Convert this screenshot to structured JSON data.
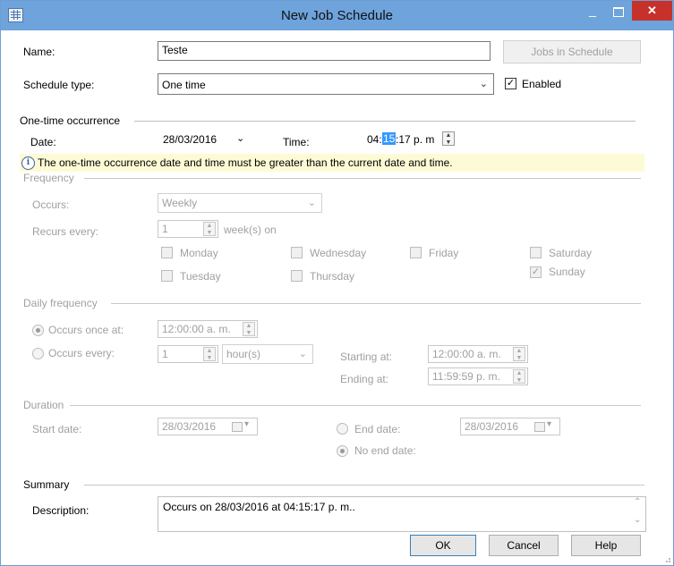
{
  "window": {
    "title": "New Job Schedule",
    "minimize_glyph": "_",
    "close_glyph": "✕"
  },
  "icons": {
    "app": "calendar-grid-icon",
    "info": "info-icon"
  },
  "name": {
    "label": "Name:",
    "value": "Teste",
    "jobs_button": "Jobs in Schedule"
  },
  "schedule_type": {
    "label": "Schedule type:",
    "value": "One time",
    "enabled_label": "Enabled",
    "enabled": true
  },
  "one_time": {
    "section": "One-time occurrence",
    "date_label": "Date:",
    "date_value": "28/03/2016",
    "time_label": "Time:",
    "time_prefix": "04:",
    "time_selected": "15",
    "time_suffix": ":17 p. m",
    "info_text": "The one-time occurrence date and time must be greater than the current date and time."
  },
  "frequency": {
    "section": "Frequency",
    "occurs_label": "Occurs:",
    "occurs_value": "Weekly",
    "recurs_label": "Recurs every:",
    "recurs_value": "1",
    "recurs_unit": "week(s) on",
    "days": [
      {
        "label": "Monday",
        "checked": false
      },
      {
        "label": "Wednesday",
        "checked": false
      },
      {
        "label": "Friday",
        "checked": false
      },
      {
        "label": "Saturday",
        "checked": false
      },
      {
        "label": "Tuesday",
        "checked": false
      },
      {
        "label": "Thursday",
        "checked": false
      },
      {
        "label": "Sunday",
        "checked": true
      }
    ]
  },
  "daily": {
    "section": "Daily frequency",
    "once_label": "Occurs once at:",
    "once_value": "12:00:00 a. m.",
    "every_label": "Occurs every:",
    "every_value": "1",
    "every_unit": "hour(s)",
    "starting_label": "Starting at:",
    "starting_value": "12:00:00 a. m.",
    "ending_label": "Ending at:",
    "ending_value": "11:59:59 p. m."
  },
  "duration": {
    "section": "Duration",
    "start_label": "Start date:",
    "start_value": "28/03/2016",
    "end_label": "End date:",
    "end_value": "28/03/2016",
    "no_end_label": "No end date:"
  },
  "summary": {
    "section": "Summary",
    "description_label": "Description:",
    "description": "Occurs on 28/03/2016 at 04:15:17 p. m.."
  },
  "buttons": {
    "ok": "OK",
    "cancel": "Cancel",
    "help": "Help"
  },
  "colors": {
    "titlebar": "#6ea3dc",
    "close": "#c7312c",
    "info_bg": "#fdfbd5",
    "selection": "#3399ff"
  }
}
